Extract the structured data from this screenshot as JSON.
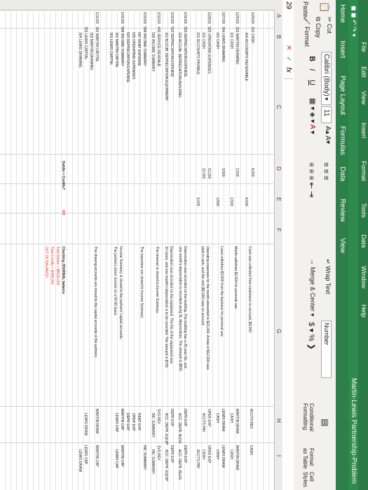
{
  "menu": [
    "File",
    "Edit",
    "View",
    "Insert",
    "Format",
    "Tools",
    "Data",
    "Window",
    "Help"
  ],
  "title": "Martin-Lewis Partnership-Problem",
  "tabs": [
    "Home",
    "Insert",
    "Page Layout",
    "Formulas",
    "Data",
    "Review",
    "View"
  ],
  "ribbon": {
    "paste": "Paste",
    "cut": "Cut",
    "copy": "Copy",
    "format": "Format",
    "font": "Calibri (Body)",
    "size": "11",
    "bold": "B",
    "italic": "I",
    "underline": "U",
    "wrap": "Wrap Text",
    "merge": "Merge & Center",
    "number_format": "Number",
    "currency": "$",
    "percent": "%",
    "conditional": "Conditional Formatting",
    "format_table": "Format as Table",
    "cell_styles": "Cell Styles"
  },
  "formula_bar": {
    "namebox": "29",
    "cancel": "✕",
    "enter": "✓",
    "fx": "fx"
  },
  "columns": [
    "A",
    "B",
    "C",
    "D",
    "E",
    "F",
    "G",
    "H",
    "I"
  ],
  "date_col": [
    "1/26/18",
    "",
    "1/26/18",
    "",
    "1/27/18",
    "",
    "1/28/18",
    "",
    "",
    "1/31/18",
    "",
    "1/31/18",
    "",
    "1/31/18",
    "",
    "1/31/18",
    "",
    "1/31/18",
    "",
    "1/31/18",
    ""
  ],
  "accounts": [
    "101 CASH",
    "104 ACCOUNTS RECEIVABLE",
    "302 MARTIN DRAWING",
    "101 CASH",
    "304 LEWIS DRAWING",
    "101 CASH",
    "525 OPERATING EXPENSES",
    "101 CASH",
    "201 ACCOUNTS PAYABLE",
    "520 DEPRECIATION EXPENSE",
    "120 ACCUM. DEPRECIATION-BUILDING",
    "520 DEPRECIATION EXPENSE",
    "111 ACCUM. DEPRECIATION-EQUIPMENT",
    "400 SERVICE REVENUE",
    "599 INCOME SUMMARY",
    "599 INCOME SUMMARY",
    "597 RENT EXPENSE",
    "525 OPERATING EXPENSES",
    "520 DEPRECIATION EXPENSE",
    "599 INCOME SUMMARY",
    "301 MARTIN CAPITAL",
    "303 LEWIS CAPITAL",
    "301 MARTIN CAPITAL",
    "302 MARTIN DRAWING",
    "303 LEWIS CAPITAL",
    "304 LEWIS DRAWING"
  ],
  "debits": [
    "8,000",
    "",
    "2,500",
    "",
    "3,500",
    "",
    "21,000",
    "12,000",
    "",
    "",
    "",
    "",
    "",
    "",
    "",
    "",
    "",
    "",
    "",
    "",
    "",
    "",
    "",
    "",
    "",
    ""
  ],
  "credits": [
    "",
    "8,000",
    "",
    "2,500",
    "",
    "3,500",
    "",
    "",
    "9,000",
    "",
    "",
    "",
    "",
    "",
    "",
    "",
    "",
    "",
    "",
    "",
    "",
    "",
    "",
    "",
    "",
    ""
  ],
  "explanations": [
    "Cash was collected from customers on account, $8,000.",
    "Martin withdrew $2,500 for personal use.",
    "Lewis withdrew $3,500 from the business for personal use.",
    "Operating expenses for the month amounted to $21,000. A total of $12,000 was",
    "paid in cash, and the rest ($9,000) was on account.",
    "Depreciation was recorded on the building. The building has a 25 year life, and",
    "one month's depreciation is recorded using SL depreciation. The amount is $800.",
    "Depreciation was recorded on the equipment. The life of the equipment was",
    "10 years, and one month's depreciation is to be recorded. The amount is $700.",
    "The revenue is closed to Income Summary.",
    "The expenses are closed to Income Summary.",
    "Income Summary is closed to the partners' capital accounts.",
    "The partners share income on a 50-50 basis.",
    "The drawing accounts are closed to the capital accounts of the partners."
  ],
  "col_h": [
    "ACCTS REC",
    "MARTIN DRAW",
    "CASH",
    "LEWIS DRAW",
    "CASH",
    "OPER EXP",
    "ACCTS PAY",
    "DEPR EXP",
    "ACC. DEPR. BLDG",
    "DEPR EXP",
    "ACC. DEPR. EQUIP",
    "SVS REV",
    "INC SUMMARY",
    "RENT EXP",
    "OPER EXP",
    "DEPR EXP",
    "MARTIN CAP",
    "LEWIS CAP",
    "MARTIN DRAW",
    "LEWIS DRAW"
  ],
  "col_i": [
    "CASH",
    "MARTIN DRAW",
    "CASH",
    "LEWIS DRAW",
    "CASH",
    "OPER EXP",
    "CASH",
    "ACCTS PAY",
    "DEPR EXP",
    "ACC. DEPR. BLDG",
    "DEPR EXP",
    "ACC. DEPR. EQUIP",
    "SVS REV",
    "INC SUMMARY",
    "INC SUMMARY",
    "MARTIN CAP",
    "LEWIS CAP",
    "MARTIN CAP",
    "LEWIS CAP",
    "LEWIS DRAW"
  ],
  "check": {
    "label": "Debits = Credits?",
    "result": "NO",
    "heading": "Checking JOURNAL balance",
    "debits": "Total Debits = $5532,000",
    "credits": "Total Credits = $488,000",
    "status": "OUT OF BALANCE!"
  }
}
